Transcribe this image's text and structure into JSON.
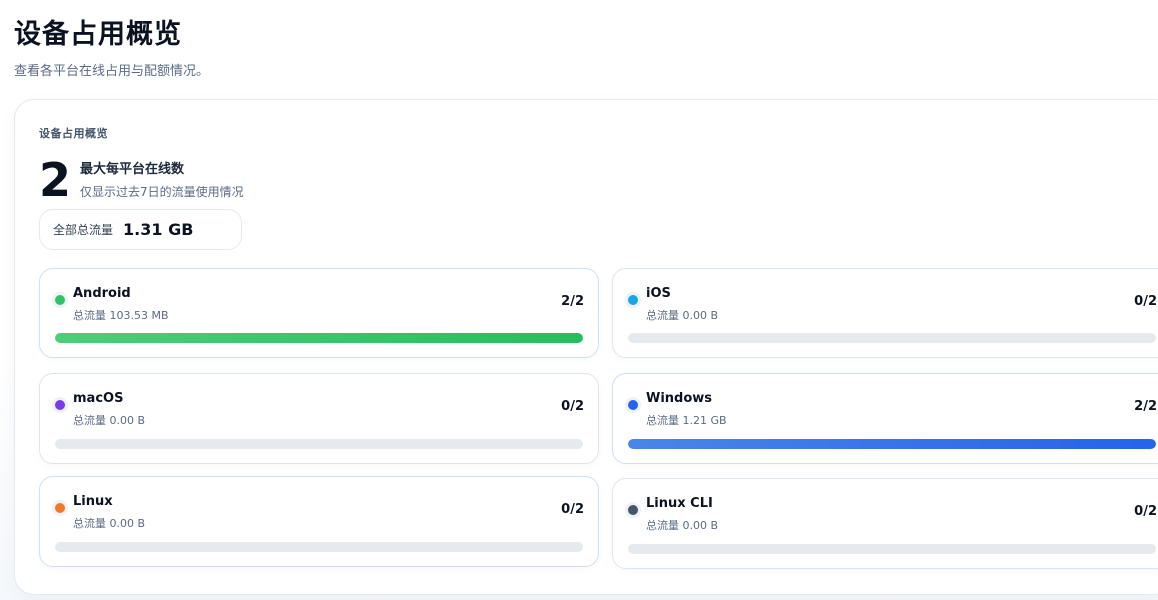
{
  "header": {
    "title": "设备占用概览",
    "subtitle": "查看各平台在线占用与配额情况。"
  },
  "overview": {
    "card_title": "设备占用概览",
    "max_online": "2",
    "max_online_label": "最大每平台在线数",
    "description": "仅显示过去7日的流量使用情况",
    "total_label": "全部总流量",
    "total_value": "1.31 GB"
  },
  "platforms": [
    {
      "name": "Android",
      "traffic": "总流量 103.53 MB",
      "count": "2/2",
      "usage": 1.0,
      "color": "#2fc366",
      "fill": "linear-gradient(90deg,#4bcf78,#22c05c)"
    },
    {
      "name": "iOS",
      "traffic": "总流量 0.00 B",
      "count": "0/2",
      "usage": 0.0,
      "color": "#1ba6e6",
      "fill": "#1ba6e6"
    },
    {
      "name": "macOS",
      "traffic": "总流量 0.00 B",
      "count": "0/2",
      "usage": 0.0,
      "color": "#7c3aed",
      "fill": "#7c3aed"
    },
    {
      "name": "Windows",
      "traffic": "总流量 1.21 GB",
      "count": "2/2",
      "usage": 1.0,
      "color": "#2563eb",
      "fill": "linear-gradient(90deg,#4a86e8,#2563eb)"
    },
    {
      "name": "Linux",
      "traffic": "总流量 0.00 B",
      "count": "0/2",
      "usage": 0.0,
      "color": "#f07a2a",
      "fill": "#f07a2a"
    },
    {
      "name": "Linux CLI",
      "traffic": "总流量 0.00 B",
      "count": "0/2",
      "usage": 0.0,
      "color": "#475569",
      "fill": "#475569"
    }
  ]
}
